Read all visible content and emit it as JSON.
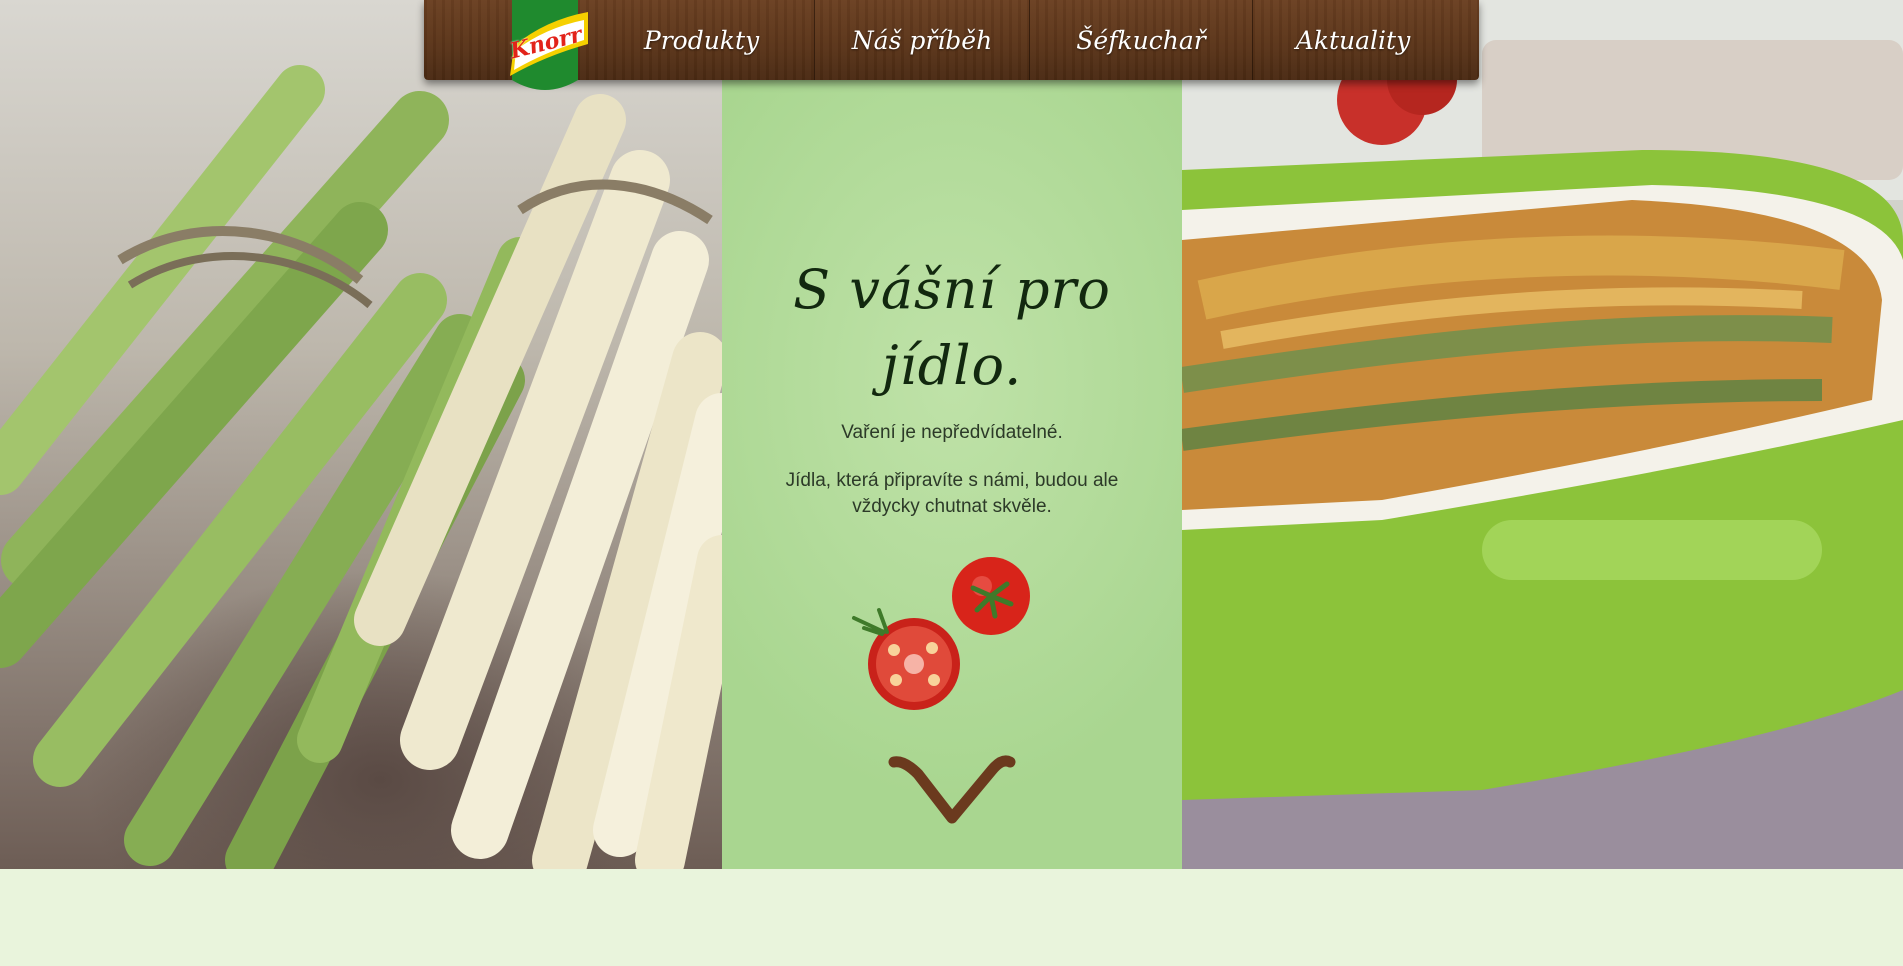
{
  "nav": {
    "logo_text": "Knorr",
    "items": [
      {
        "label": "Produkty"
      },
      {
        "label": "Náš příběh"
      },
      {
        "label": "Šéfkuchař"
      },
      {
        "label": "Aktuality"
      }
    ]
  },
  "hero": {
    "headline_line1": "S vášní pro",
    "headline_line2": "jídlo.",
    "subtitle": "Vaření je nepředvídatelné.",
    "text": "Jídla, která připravíte s námi, budou ale vždycky chutnat skvěle.",
    "scroll_icon": "chevron-down-icon"
  },
  "colors": {
    "panel_green": "#b5dc9b",
    "page_background": "#e9f4dc",
    "nav_wood": "#5a3419",
    "knorr_red": "#e2231a",
    "knorr_green": "#1f8a2e"
  }
}
